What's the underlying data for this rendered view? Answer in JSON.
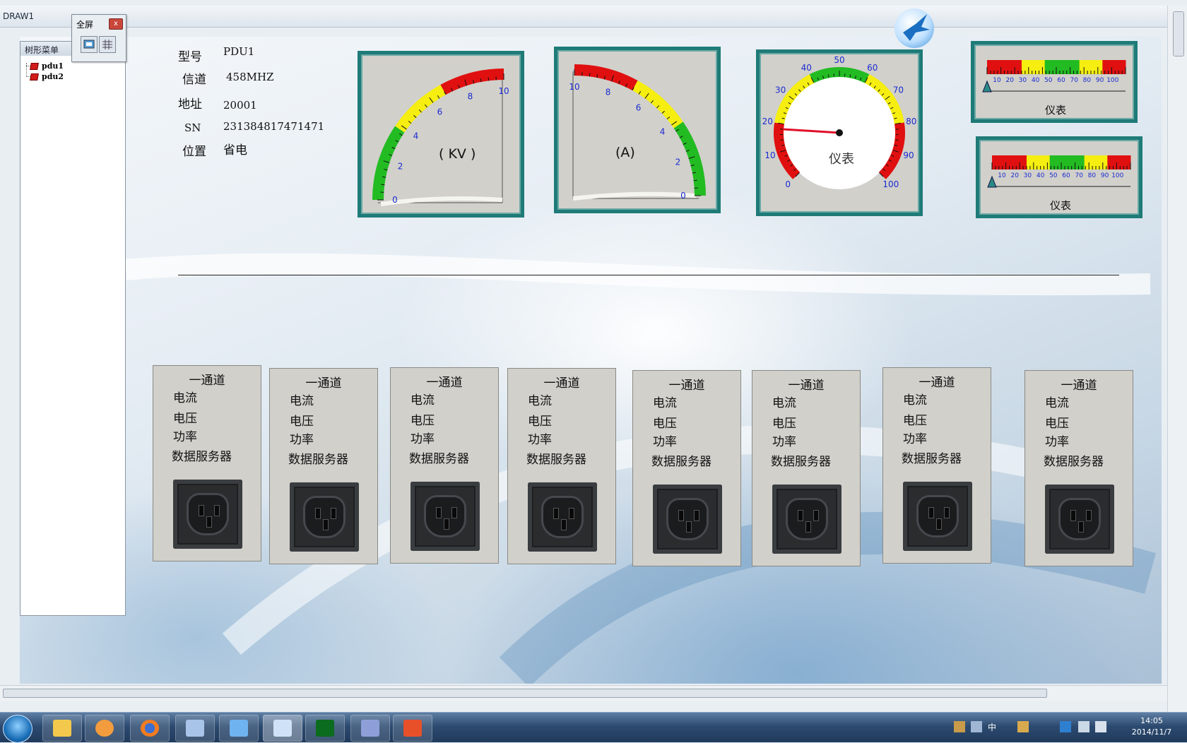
{
  "window": {
    "title": "DRAW1"
  },
  "palette": {
    "title": "全屏",
    "close": "x"
  },
  "tree": {
    "header": "树形菜单",
    "items": [
      {
        "label": "pdu1"
      },
      {
        "label": "pdu2"
      }
    ]
  },
  "info": {
    "model_label": "型号",
    "model": "PDU1",
    "channel_label": "信道",
    "channel": "458MHZ",
    "address_label": "地址",
    "address": "20001",
    "sn_label": "SN",
    "sn": "231384817471471",
    "location_label": "位置",
    "location": "省电"
  },
  "gauges": {
    "voltage": {
      "unit": "( KV )",
      "ticks": [
        "0",
        "2",
        "4",
        "6",
        "8",
        "10"
      ],
      "min": 0,
      "max": 10,
      "value": 0
    },
    "current": {
      "unit": "(A)",
      "ticks": [
        "10",
        "8",
        "6",
        "4",
        "2",
        "0"
      ],
      "min": 0,
      "max": 10,
      "value": 0
    },
    "dial": {
      "label": "仪表",
      "ticks": [
        "0",
        "10",
        "20",
        "30",
        "40",
        "50",
        "60",
        "70",
        "80",
        "90",
        "100"
      ],
      "value": 18
    },
    "bar1": {
      "label": "仪表",
      "ticks": [
        "10",
        "20",
        "30",
        "40",
        "50",
        "60",
        "70",
        "80",
        "90",
        "100"
      ],
      "value": 0
    },
    "bar2": {
      "label": "仪表",
      "ticks": [
        "10",
        "20",
        "30",
        "40",
        "50",
        "60",
        "70",
        "80",
        "90",
        "100"
      ],
      "value": 0
    }
  },
  "channels": [
    {
      "title": "一通道",
      "current": "电流",
      "voltage": "电压",
      "power": "功率",
      "server": "数据服务器"
    },
    {
      "title": "一通道",
      "current": "电流",
      "voltage": "电压",
      "power": "功率",
      "server": "数据服务器"
    },
    {
      "title": "一通道",
      "current": "电流",
      "voltage": "电压",
      "power": "功率",
      "server": "数据服务器"
    },
    {
      "title": "一通道",
      "current": "电流",
      "voltage": "电压",
      "power": "功率",
      "server": "数据服务器"
    },
    {
      "title": "一通道",
      "current": "电流",
      "voltage": "电压",
      "power": "功率",
      "server": "数据服务器"
    },
    {
      "title": "一通道",
      "current": "电流",
      "voltage": "电压",
      "power": "功率",
      "server": "数据服务器"
    },
    {
      "title": "一通道",
      "current": "电流",
      "voltage": "电压",
      "power": "功率",
      "server": "数据服务器"
    },
    {
      "title": "一通道",
      "current": "电流",
      "voltage": "电压",
      "power": "功率",
      "server": "数据服务器"
    }
  ],
  "taskbar": {
    "apps": [
      "start-icon",
      "file-explorer-icon",
      "media-player-icon",
      "firefox-icon",
      "app-list-icon",
      "bird-app-icon",
      "display-settings-icon",
      "led-app-icon",
      "network-app-icon",
      "user-avatar-icon"
    ],
    "tray_ime": "中",
    "time": "14:05",
    "date": "2014/11/7"
  },
  "colors": {
    "gauge_frame": "#1f7b77",
    "panel_bg": "#d1d0cb",
    "red": "#e01010",
    "yellow": "#f5ee10",
    "green": "#22bb22"
  }
}
